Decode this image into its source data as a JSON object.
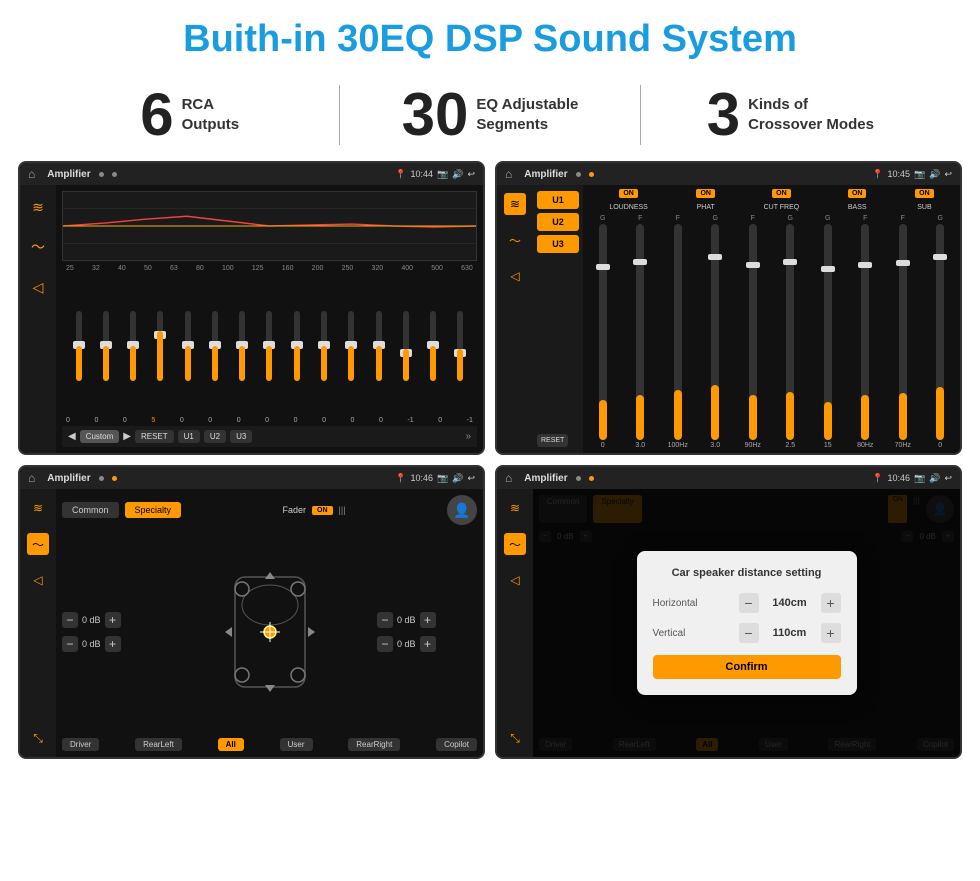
{
  "page": {
    "title": "Buith-in 30EQ DSP Sound System",
    "background": "#ffffff"
  },
  "stats": {
    "items": [
      {
        "number": "6",
        "line1": "RCA",
        "line2": "Outputs"
      },
      {
        "number": "30",
        "line1": "EQ Adjustable",
        "line2": "Segments"
      },
      {
        "number": "3",
        "line1": "Kinds of",
        "line2": "Crossover Modes"
      }
    ]
  },
  "screens": {
    "eq": {
      "title": "Amplifier",
      "time": "10:44",
      "freqs": [
        "25",
        "32",
        "40",
        "50",
        "63",
        "80",
        "100",
        "125",
        "160",
        "200",
        "250",
        "320",
        "400",
        "500",
        "630"
      ],
      "values": [
        "0",
        "0",
        "0",
        "5",
        "0",
        "0",
        "0",
        "0",
        "0",
        "0",
        "0",
        "0",
        "-1",
        "0",
        "-1"
      ],
      "buttons": [
        "Custom",
        "RESET",
        "U1",
        "U2",
        "U3"
      ]
    },
    "crossover": {
      "title": "Amplifier",
      "time": "10:45",
      "presets": [
        "U1",
        "U2",
        "U3"
      ],
      "toggleLabel": "ON",
      "channels": [
        "LOUDNESS",
        "PHAT",
        "CUT FREQ",
        "BASS",
        "SUB"
      ],
      "resetLabel": "RESET"
    },
    "fader": {
      "title": "Amplifier",
      "time": "10:46",
      "tabs": [
        "Common",
        "Specialty"
      ],
      "activeTab": "Specialty",
      "faderLabel": "Fader",
      "toggleLabel": "ON",
      "locations": [
        "Driver",
        "RearLeft",
        "All",
        "User",
        "RearRight",
        "Copilot"
      ],
      "dbValues": [
        "0 dB",
        "0 dB",
        "0 dB",
        "0 dB"
      ]
    },
    "distance": {
      "title": "Amplifier",
      "time": "10:46",
      "tabs": [
        "Common",
        "Specialty"
      ],
      "dialog": {
        "title": "Car speaker distance setting",
        "horizontal_label": "Horizontal",
        "horizontal_value": "140cm",
        "vertical_label": "Vertical",
        "vertical_value": "110cm",
        "confirm_label": "Confirm"
      },
      "locations": [
        "Driver",
        "RearLeft",
        "All",
        "User",
        "RearRight",
        "Copilot"
      ],
      "dbValues": [
        "0 dB",
        "0 dB"
      ]
    }
  }
}
